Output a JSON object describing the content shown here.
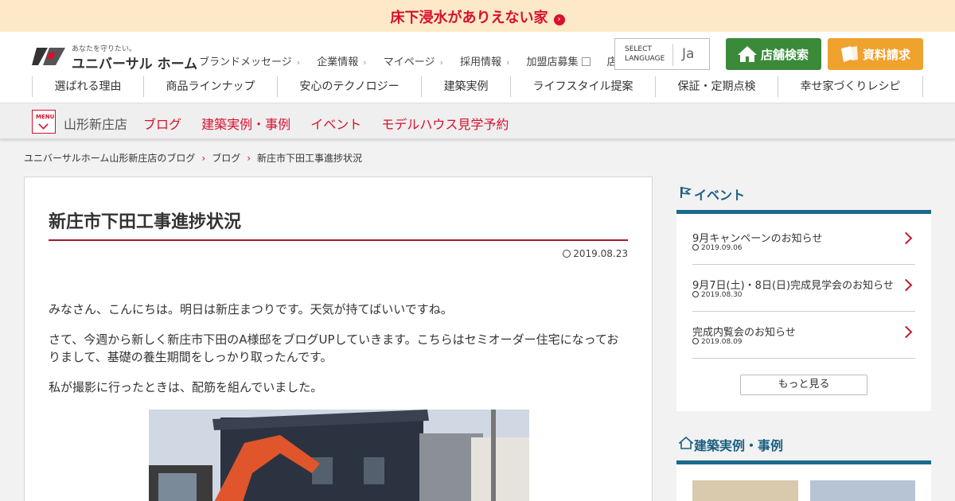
{
  "top_banner": {
    "text": "床下浸水がありえない家",
    "arrow": "›"
  },
  "logo": {
    "tagline": "あなたを守りたい。",
    "name": "ユニバーサル ホーム"
  },
  "util_nav": [
    {
      "label": "ブランドメッセージ",
      "marker": "›"
    },
    {
      "label": "企業情報",
      "marker": "›"
    },
    {
      "label": "マイページ",
      "marker": "›"
    },
    {
      "label": "採用情報",
      "marker": "›"
    },
    {
      "label": "加盟店募集",
      "marker": "external"
    },
    {
      "label": "店舗採用情報",
      "marker": "external"
    }
  ],
  "lang_selector": {
    "select_text": "SELECT",
    "label_text": "LANGUAGE",
    "value": "Ja"
  },
  "buttons": {
    "store_search": "店舗検索",
    "request_docs": "資料請求"
  },
  "main_nav": [
    "選ばれる理由",
    "商品ラインナップ",
    "安心のテクノロジー",
    "建築実例",
    "ライフスタイル提案",
    "保証・定期点検",
    "幸せ家づくりレシピ"
  ],
  "store_bar": {
    "menu_text": "MENU",
    "store_name": "山形新庄店",
    "links": [
      "ブログ",
      "建築実例・事例",
      "イベント",
      "モデルハウス見学予約"
    ]
  },
  "breadcrumb": [
    "ユニバーサルホーム山形新庄店のブログ",
    "ブログ",
    "新庄市下田工事進捗状況"
  ],
  "article": {
    "title": "新庄市下田工事進捗状況",
    "date": "2019.08.23",
    "paragraphs": [
      "みなさん、こんにちは。明日は新庄まつりです。天気が持てばいいですね。",
      "さて、今週から新しく新庄市下田のA様邸をブログUPしていきます。こちらはセミオーダー住宅になっておりまして、基礎の養生期間をしっかり取ったんです。",
      "私が撮影に行ったときは、配筋を組んでいました。"
    ]
  },
  "events": {
    "title": "イベント",
    "items": [
      {
        "title": "9月キャンペーンのお知らせ",
        "date": "2019.09.06"
      },
      {
        "title": "9月7日(土)・8日(日)完成見学会のお知らせ",
        "date": "2019.08.30"
      },
      {
        "title": "完成内覧会のお知らせ",
        "date": "2019.08.09"
      }
    ],
    "more_label": "もっと見る"
  },
  "examples": {
    "title": "建築実例・事例"
  },
  "colors": {
    "accent_red": "#d7102e",
    "store_green": "#3a8a3a",
    "doc_orange": "#f0a22e",
    "sidebar_blue": "#1a6a8c"
  }
}
